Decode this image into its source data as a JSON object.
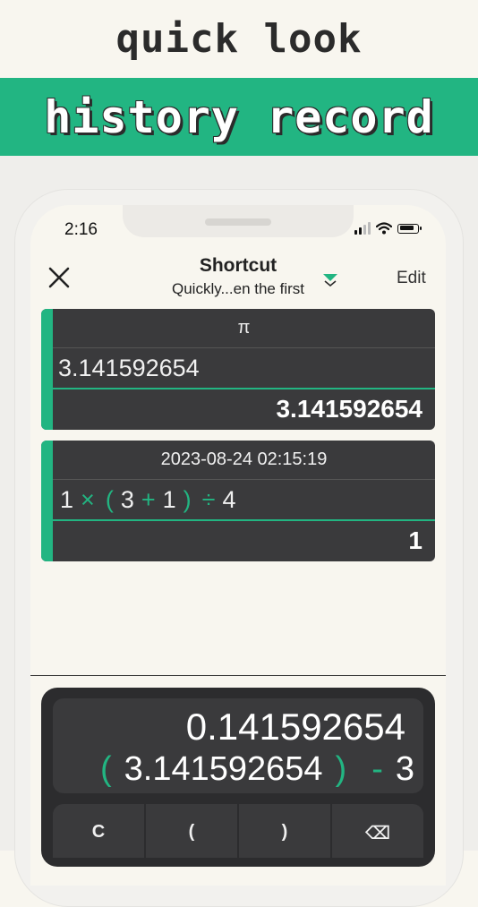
{
  "banner": {
    "top_text": "quick look",
    "main_text": "history record"
  },
  "status_bar": {
    "time": "2:16"
  },
  "header": {
    "title": "Shortcut",
    "subtitle": "Quickly...en the first",
    "edit_label": "Edit"
  },
  "history": [
    {
      "header": "π",
      "expression": "3.141592654",
      "result": "3.141592654"
    },
    {
      "header": "2023-08-24 02:15:19",
      "expr_parts": [
        "1",
        "×",
        "(",
        "3",
        "+",
        "1",
        ")",
        "÷",
        "4"
      ],
      "result": "1"
    }
  ],
  "calculator": {
    "result": "0.141592654",
    "expr_parts": [
      "(",
      "3.141592654",
      ")",
      "-",
      "3"
    ],
    "keys": [
      "C",
      "(",
      ")",
      "⌫"
    ]
  },
  "colors": {
    "accent": "#22b582",
    "card": "#3a3a3c",
    "background": "#f8f6ef"
  }
}
